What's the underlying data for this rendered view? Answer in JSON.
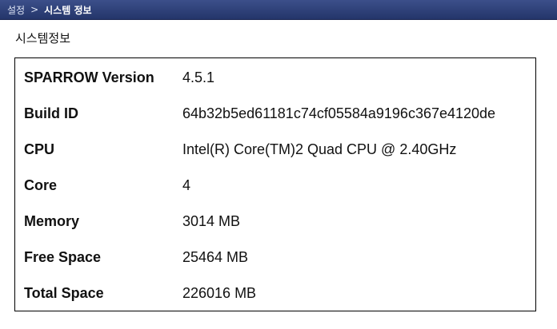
{
  "breadcrumb": {
    "root": "설정",
    "separator": ">",
    "current": "시스템 정보"
  },
  "page": {
    "title": "시스템정보"
  },
  "system_info": {
    "rows": [
      {
        "label": "SPARROW Version",
        "value": "4.5.1"
      },
      {
        "label": "Build ID",
        "value": "64b32b5ed61181c74cf05584a9196c367e4120de"
      },
      {
        "label": "CPU",
        "value": "Intel(R) Core(TM)2 Quad CPU @ 2.40GHz"
      },
      {
        "label": "Core",
        "value": "4"
      },
      {
        "label": "Memory",
        "value": "3014 MB"
      },
      {
        "label": "Free Space",
        "value": "25464 MB"
      },
      {
        "label": "Total Space",
        "value": "226016 MB"
      }
    ]
  },
  "colors": {
    "topbar": "#2c3d78",
    "border": "#000000"
  }
}
